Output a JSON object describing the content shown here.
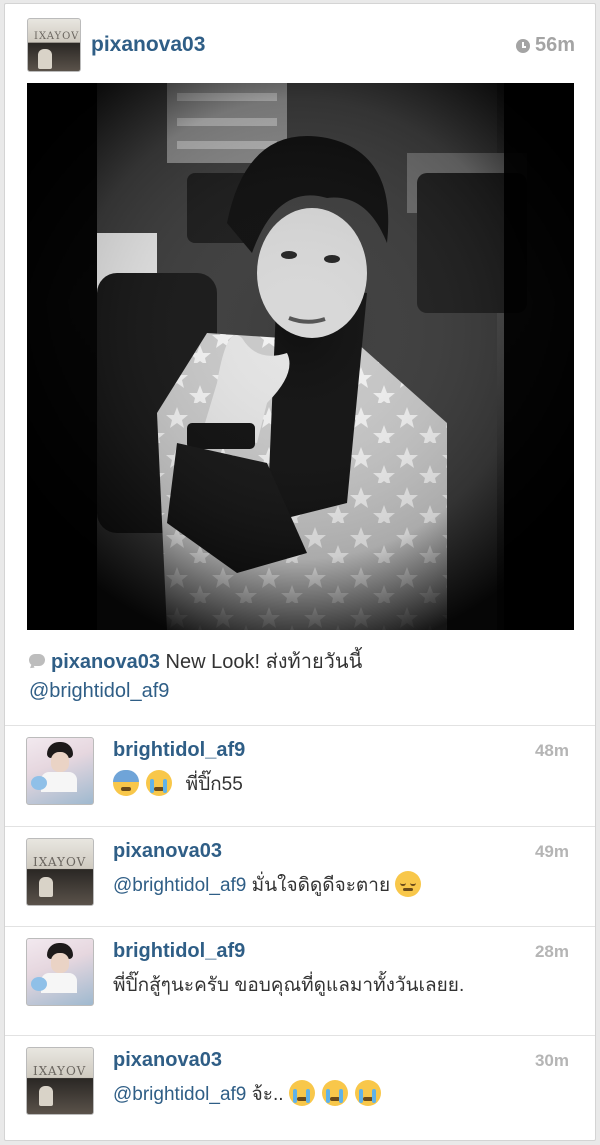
{
  "post": {
    "username": "pixanova03",
    "time": "56m",
    "caption_user": "pixanova03",
    "caption_text": "New Look! ส่งท้ายวันนี้",
    "caption_mention": "@brightidol_af9"
  },
  "comments": [
    {
      "user": "brightidol_af9",
      "time": "48m",
      "text": "พี่ปิ๊ก55",
      "mention": "",
      "emojis_before": [
        "fearful-face-emoji",
        "crying-face-emoji"
      ],
      "emojis_after": []
    },
    {
      "user": "pixanova03",
      "time": "49m",
      "text": "มั่นใจดิดูดีจะตาย",
      "mention": "@brightidol_af9",
      "emojis_before": [],
      "emojis_after": [
        "relieved-face-emoji"
      ]
    },
    {
      "user": "brightidol_af9",
      "time": "28m",
      "text": "พี่ปิ๊กสู้ๆนะครับ ขอบคุณที่ดูแลมาทั้งวันเลยย.",
      "mention": "",
      "emojis_before": [],
      "emojis_after": []
    },
    {
      "user": "pixanova03",
      "time": "30m",
      "text": "จ้ะ..",
      "mention": "@brightidol_af9",
      "emojis_before": [],
      "emojis_after": [
        "crying-face-emoji",
        "crying-face-emoji",
        "crying-face-emoji"
      ]
    }
  ],
  "avatars": {
    "pixanova03_text": "IXAYOV"
  },
  "colors": {
    "username_blue": "#2f5e86",
    "time_gray": "#a4a4a4",
    "text": "#333333",
    "divider": "#e2e2e2"
  }
}
